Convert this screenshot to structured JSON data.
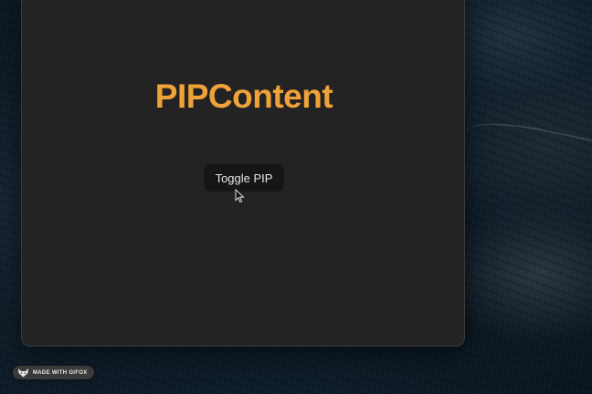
{
  "window": {
    "title_text": "PIPContent",
    "title_color": "#f0a23a",
    "background_color": "#232323"
  },
  "toggle_button": {
    "label": "Toggle PIP"
  },
  "watermark": {
    "text": "MADE WITH GIFOX",
    "icon": "fox-icon"
  },
  "cursor": {
    "icon": "pointer-cursor-icon"
  }
}
